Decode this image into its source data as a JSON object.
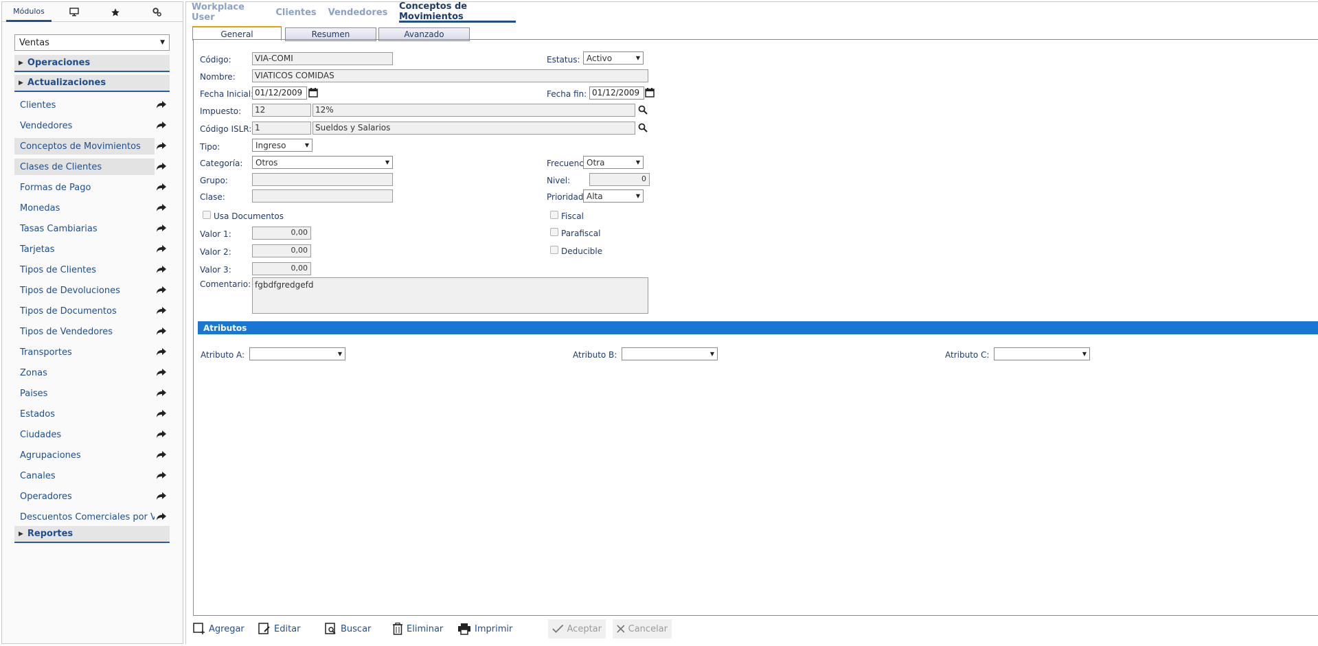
{
  "left_tabs": {
    "modulos_label": "Módulos"
  },
  "module_select": {
    "value": "Ventas"
  },
  "sections": {
    "operaciones": "Operaciones",
    "actualizaciones": "Actualizaciones",
    "reportes": "Reportes"
  },
  "menu_items": [
    "Clientes",
    "Vendedores",
    "Conceptos de Movimientos",
    "Clases de Clientes",
    "Formas de Pago",
    "Monedas",
    "Tasas Cambiarias",
    "Tarjetas",
    "Tipos de Clientes",
    "Tipos de Devoluciones",
    "Tipos de Documentos",
    "Tipos de Vendedores",
    "Transportes",
    "Zonas",
    "Paises",
    "Estados",
    "Ciudades",
    "Agrupaciones",
    "Canales",
    "Operadores",
    "Descuentos Comerciales por V"
  ],
  "top_tabs": [
    "Workplace User",
    "Clientes",
    "Vendedores",
    "Conceptos de Movimientos"
  ],
  "form_tabs": [
    "General",
    "Resumen",
    "Avanzado"
  ],
  "form": {
    "codigo_label": "Código:",
    "codigo_value": "VIA-COMI",
    "estatus_label": "Estatus:",
    "estatus_value": "Activo",
    "nombre_label": "Nombre:",
    "nombre_value": "VIATICOS COMIDAS",
    "fecha_inicial_label": "Fecha Inicial:",
    "fecha_inicial_value": "01/12/2009",
    "fecha_fin_label": "Fecha fin:",
    "fecha_fin_value": "01/12/2009",
    "impuesto_label": "Impuesto:",
    "impuesto_code": "12",
    "impuesto_desc": "12%",
    "islr_label": "Código ISLR:",
    "islr_code": "1",
    "islr_desc": "Sueldos y Salarios",
    "tipo_label": "Tipo:",
    "tipo_value": "Ingreso",
    "categoria_label": "Categoría:",
    "categoria_value": "Otros",
    "frecuencia_label": "Frecuencia:",
    "frecuencia_value": "Otra",
    "grupo_label": "Grupo:",
    "grupo_value": "",
    "nivel_label": "Nivel:",
    "nivel_value": "0",
    "clase_label": "Clase:",
    "clase_value": "",
    "prioridad_label": "Prioridad:",
    "prioridad_value": "Alta",
    "usa_documentos_label": "Usa Documentos",
    "fiscal_label": "Fiscal",
    "parafiscal_label": "Parafiscal",
    "deducible_label": "Deducible",
    "valor1_label": "Valor 1:",
    "valor1_value": "0,00",
    "valor2_label": "Valor 2:",
    "valor2_value": "0,00",
    "valor3_label": "Valor 3:",
    "valor3_value": "0,00",
    "comentario_label": "Comentario:",
    "comentario_value": "fgbdfgredgefd"
  },
  "atributos": {
    "title": "Atributos",
    "a_label": "Atributo A:",
    "a_value": "",
    "b_label": "Atributo B:",
    "b_value": "",
    "c_label": "Atributo C:",
    "c_value": ""
  },
  "toolbar": {
    "agregar": "Agregar",
    "editar": "Editar",
    "buscar": "Buscar",
    "eliminar": "Eliminar",
    "imprimir": "Imprimir",
    "aceptar": "Aceptar",
    "cancelar": "Cancelar"
  },
  "colors": {
    "accent": "#1f4e8c",
    "section_bar": "#1976d2",
    "tab_highlight": "#e3a000"
  },
  "icons": [
    "monitor-icon",
    "star-icon",
    "gears-icon",
    "share-arrow-icon",
    "calendar-icon",
    "search-icon",
    "add-icon",
    "edit-icon",
    "search-doc-icon",
    "trash-icon",
    "printer-icon",
    "check-icon",
    "close-icon"
  ]
}
